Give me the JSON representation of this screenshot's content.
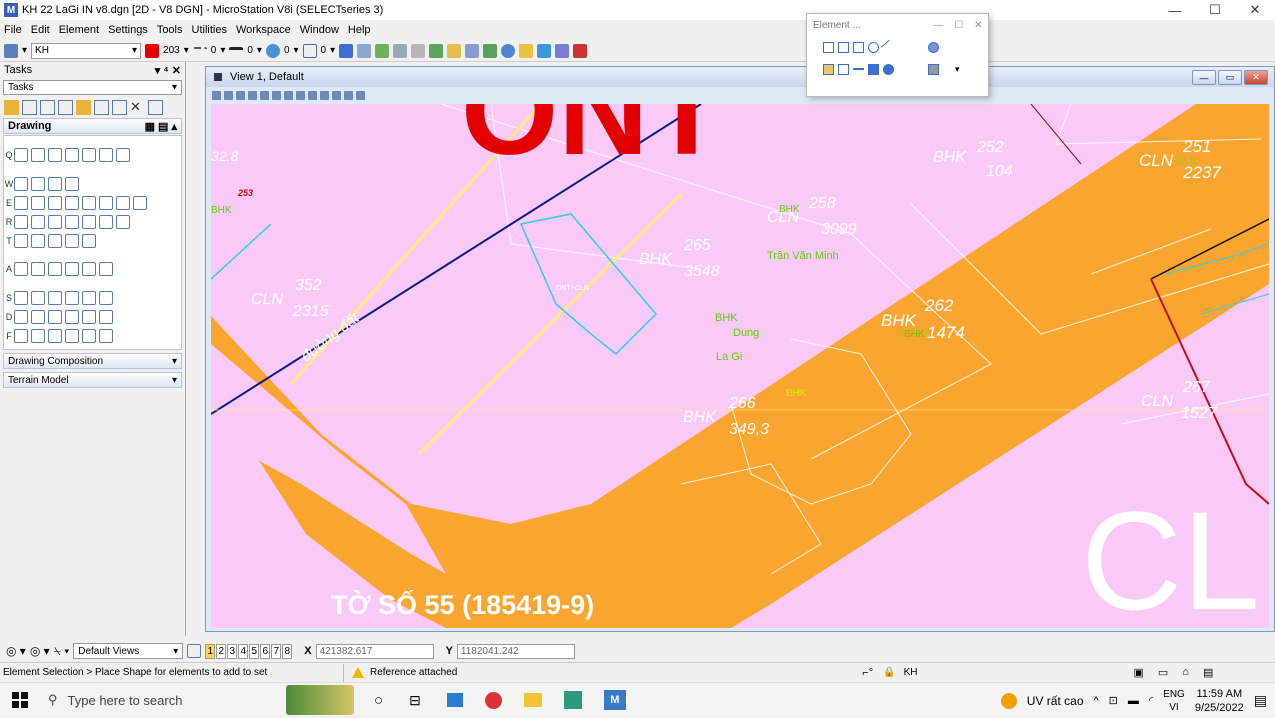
{
  "window": {
    "title": "KH 22 LaGi IN v8.dgn [2D - V8 DGN] - MicroStation V8i (SELECTseries 3)",
    "min": "—",
    "max": "☐",
    "close": "✕"
  },
  "menu": [
    "File",
    "Edit",
    "Element",
    "Settings",
    "Tools",
    "Utilities",
    "Workspace",
    "Window",
    "Help"
  ],
  "toolbar": {
    "level": "KH",
    "color": "203",
    "style": "0",
    "weight": "0",
    "transparency": "0",
    "priority": "0",
    "accent_color": "#e30000"
  },
  "tasks": {
    "header": "Tasks",
    "selected": "Tasks",
    "drawing_label": "Drawing",
    "groups": [
      "Q",
      "W",
      "E",
      "R",
      "T",
      "A",
      "S",
      "D",
      "F"
    ],
    "sections": [
      "Drawing Composition",
      "Terrain Model"
    ]
  },
  "element_dialog": {
    "title": "Element ..."
  },
  "view": {
    "title": "View 1, Default"
  },
  "map": {
    "bg_color": "#fbc9f8",
    "road_color": "#f9a530",
    "big_labels": [
      "ONT",
      "CL"
    ],
    "sheet_label": "TỜ SỐ 55 (185419-9)",
    "parcels": [
      {
        "code": "BHK",
        "number": "252",
        "area": "104"
      },
      {
        "code": "CLN",
        "number": "251",
        "area": "2237"
      },
      {
        "code": "CLN",
        "number": "258",
        "area": "3099"
      },
      {
        "code": "BHK",
        "number": "265",
        "area": "3548"
      },
      {
        "code": "CLN",
        "number": "352",
        "area": "2315"
      },
      {
        "code": "BHK",
        "number": "262",
        "area": "1474"
      },
      {
        "code": "BHK",
        "number": "266",
        "area": "349,3"
      },
      {
        "code": "CLN",
        "number": "267",
        "area": "1527"
      }
    ],
    "misc_labels": {
      "left_number": "32.8",
      "lot_253": "253",
      "bhk_left": "BHK",
      "owner_1": "Trần Văn Minh",
      "bhk_dung": "BHK",
      "owner_2": "Dung",
      "place": "La Gi",
      "road": "đường đất",
      "ont_cln": "ONT+CLN",
      "bhk_266": "BHK",
      "bhk_258": "BHK",
      "cln_251": "CLN",
      "bhk_262": "BHK"
    }
  },
  "viewbar": {
    "views_label": "Default Views",
    "view_numbers": [
      "1",
      "2",
      "3",
      "4",
      "5",
      "6",
      "7",
      "8"
    ],
    "x_label": "X",
    "x_value": "421382.617",
    "y_label": "Y",
    "y_value": "1182041.242"
  },
  "status": {
    "message": "Element Selection > Place Shape for elements to add to set",
    "reference": "Reference attached",
    "level": "KH"
  },
  "taskbar": {
    "search_placeholder": "Type here to search",
    "weather": "UV rất cao",
    "lang1": "ENG",
    "lang2": "VI",
    "time": "11:59 AM",
    "date": "9/25/2022"
  }
}
